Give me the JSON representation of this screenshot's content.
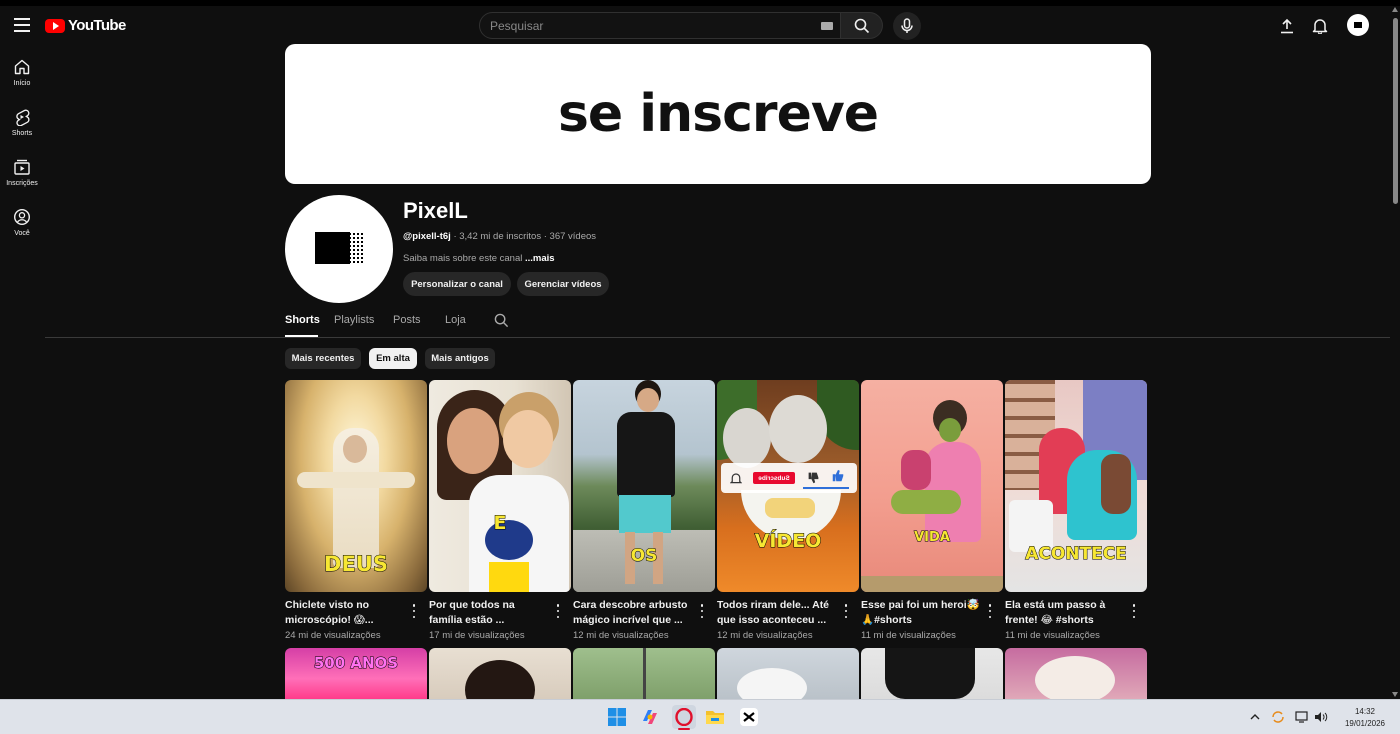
{
  "header": {
    "logo_text": "YouTube",
    "search_placeholder": "Pesquisar"
  },
  "guide": {
    "items": [
      {
        "label": "Início",
        "icon": "home-icon"
      },
      {
        "label": "Shorts",
        "icon": "shorts-icon"
      },
      {
        "label": "Inscrições",
        "icon": "subscriptions-icon"
      },
      {
        "label": "Você",
        "icon": "you-icon"
      }
    ]
  },
  "banner": {
    "text": "se inscreve"
  },
  "channel": {
    "name": "PixelL",
    "handle": "@pixell-t6j",
    "stats": " · 3,42 mi de inscritos · 367 vídeos",
    "about": "Saiba mais sobre este canal ",
    "about_more": "...mais",
    "customize_label": "Personalizar o canal",
    "manage_label": "Gerenciar vídeos"
  },
  "tabs": [
    "Shorts",
    "Playlists",
    "Posts",
    "Loja"
  ],
  "chips": [
    "Mais recentes",
    "Em alta",
    "Mais antigos"
  ],
  "shorts": [
    {
      "title_line1": "Chiclete visto no",
      "title_line2": "microscópio! 😱...",
      "views": "24 mi de visualizações",
      "caption": "DEUS"
    },
    {
      "title_line1": "Por que todos na",
      "title_line2": "família estão ...",
      "views": "17 mi de visualizações",
      "caption": "E"
    },
    {
      "title_line1": "Cara descobre arbusto",
      "title_line2": "mágico incrível que ...",
      "views": "12 mi de visualizações",
      "caption": "OS"
    },
    {
      "title_line1": "Todos riram dele... Até",
      "title_line2": "que isso aconteceu ...",
      "views": "12 mi de visualizações",
      "caption": "VÍDEO"
    },
    {
      "title_line1": "Esse pai foi um heroi🤯",
      "title_line2": "🙏#shorts",
      "views": "11 mi de visualizações",
      "caption": "VIDA"
    },
    {
      "title_line1": "Ela está um passo à",
      "title_line2": "frente! 😂 #shorts",
      "views": "11 mi de visualizações",
      "caption": "ACONTECE"
    }
  ],
  "row2_caption": "500 ANOS",
  "overlay_subscribe": "Subscribe",
  "taskbar": {
    "time": "14:32",
    "date": "19/01/2026"
  },
  "colors": {
    "background": "#0f0f0f",
    "brand_red": "#ff0000",
    "caption_yellow": "#f7e733",
    "caption_cyan": "#3ef0ff"
  }
}
